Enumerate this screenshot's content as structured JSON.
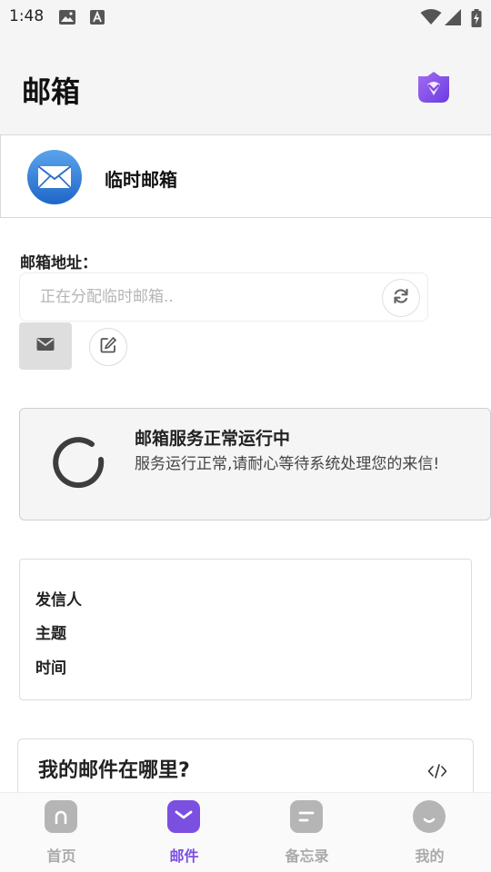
{
  "status_bar": {
    "time": "1:48"
  },
  "header": {
    "title": "邮箱"
  },
  "mail_card": {
    "title": "临时邮箱"
  },
  "address": {
    "label": "邮箱地址：",
    "placeholder": "正在分配临时邮箱.."
  },
  "status_card": {
    "title": "邮箱服务正常运行中",
    "description": "服务运行正常,请耐心等待系统处理您的来信!"
  },
  "mail_info": {
    "sender_label": "发信人",
    "subject_label": "主题",
    "time_label": "时间"
  },
  "faq": {
    "title": "我的邮件在哪里?"
  },
  "bottom_nav": {
    "items": [
      {
        "label": "首页",
        "icon": "home-icon",
        "active": false
      },
      {
        "label": "邮件",
        "icon": "mail-icon",
        "active": true
      },
      {
        "label": "备忘录",
        "icon": "memo-icon",
        "active": false
      },
      {
        "label": "我的",
        "icon": "profile-icon",
        "active": false
      }
    ]
  },
  "colors": {
    "accent": "#7b4fe0",
    "inactive": "#aaaaaa",
    "header_bg": "#f5f5f5"
  }
}
